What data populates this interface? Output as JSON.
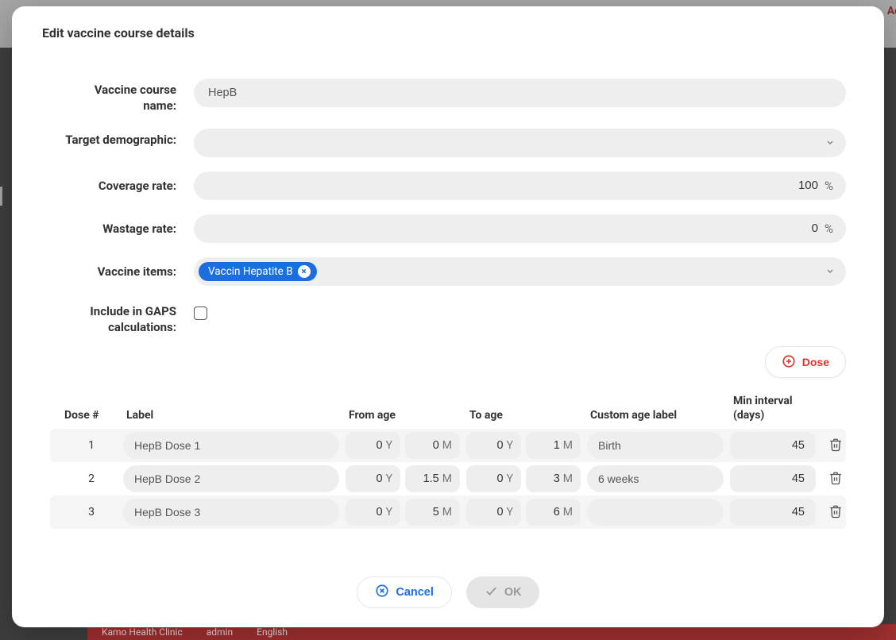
{
  "background": {
    "clinic": "Kamo Health Clinic",
    "user": "admin",
    "language": "English",
    "add": "Ad"
  },
  "modal": {
    "title": "Edit vaccine course details",
    "form": {
      "name_label": "Vaccine course name:",
      "name_value": "HepB",
      "demographic_label": "Target demographic:",
      "demographic_value": "",
      "coverage_label": "Coverage rate:",
      "coverage_value": "100",
      "wastage_label": "Wastage rate:",
      "wastage_value": "0",
      "percent": "%",
      "items_label": "Vaccine items:",
      "items_chip": "Vaccin Hepatite B",
      "gaps_label": "Include in GAPS calculations:",
      "gaps_checked": false
    },
    "dose_button": "Dose",
    "table": {
      "headers": {
        "num": "Dose #",
        "label": "Label",
        "from": "From age",
        "to": "To age",
        "custom": "Custom age label",
        "interval": "Min interval (days)"
      },
      "unit_year": "Y",
      "unit_month": "M",
      "rows": [
        {
          "num": "1",
          "label": "HepB Dose 1",
          "from_y": "0",
          "from_m": "0",
          "to_y": "0",
          "to_m": "1",
          "custom": "Birth",
          "interval": "45"
        },
        {
          "num": "2",
          "label": "HepB Dose 2",
          "from_y": "0",
          "from_m": "1.5",
          "to_y": "0",
          "to_m": "3",
          "custom": "6 weeks",
          "interval": "45"
        },
        {
          "num": "3",
          "label": "HepB Dose 3",
          "from_y": "0",
          "from_m": "5",
          "to_y": "0",
          "to_m": "6",
          "custom": "",
          "interval": "45"
        }
      ]
    },
    "footer": {
      "cancel": "Cancel",
      "ok": "OK"
    }
  }
}
